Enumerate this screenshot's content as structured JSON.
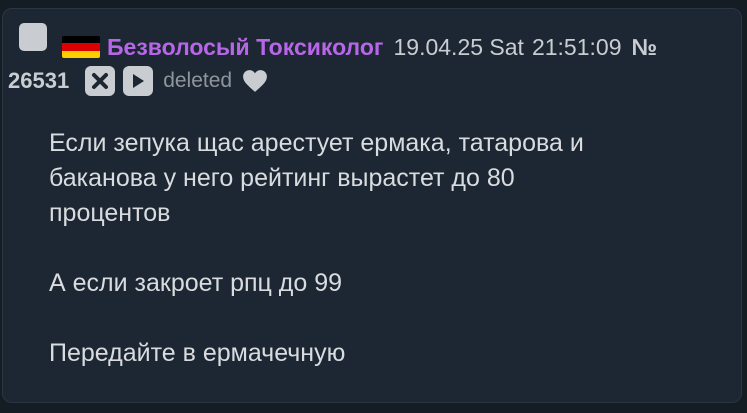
{
  "post": {
    "author": "Безволосый Токсиколог",
    "date": "19.04.25 Sat",
    "time": "21:51:09",
    "number_sign": "№",
    "number": "26531",
    "status": "deleted",
    "flag_icon": "germany-flag-icon",
    "flag_colors": [
      "#000000",
      "#dd0000",
      "#ffce00"
    ],
    "author_color": "#b866e8",
    "body": {
      "line1": "Если зепука щас арестует ермака, татарова и",
      "line2": "баканова у него рейтинг вырастет до 80",
      "line3": "процентов",
      "line4": "А если закроет рпц до 99",
      "line5": "Передайте в ермачечную"
    }
  },
  "icons": {
    "checkbox": "checkbox-icon",
    "hide": "close-icon",
    "play": "play-icon",
    "like": "heart-icon"
  }
}
